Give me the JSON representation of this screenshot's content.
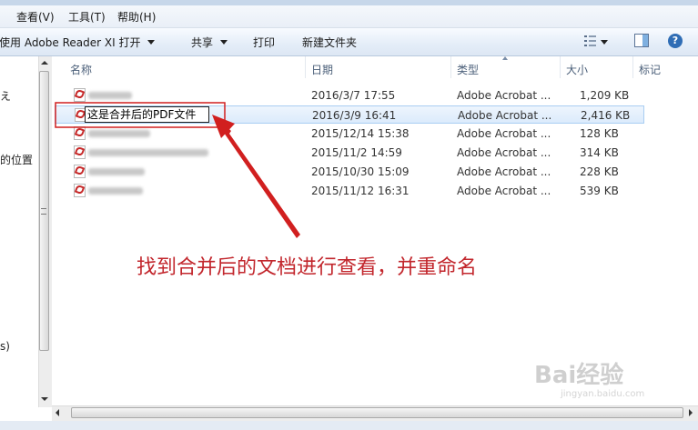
{
  "menu": [
    "查看(V)",
    "工具(T)",
    "帮助(H)"
  ],
  "toolbar": {
    "open_with": "使用 Adobe Reader XI 打开",
    "share": "共享",
    "print": "打印",
    "new_folder": "新建文件夹",
    "view_icon": "view-options-icon",
    "preview_icon": "preview-pane-icon",
    "help_icon": "help-icon"
  },
  "nav": {
    "items": [
      "え",
      "的位置",
      "s)"
    ]
  },
  "columns": [
    "名称",
    "日期",
    "类型",
    "大小",
    "标记"
  ],
  "files": [
    {
      "date": "2016/3/7 17:55",
      "type": "Adobe Acrobat ...",
      "size": "1,209 KB"
    },
    {
      "name": "这是合并后的PDF文件",
      "date": "2016/3/9 16:41",
      "type": "Adobe Acrobat ...",
      "size": "2,416 KB"
    },
    {
      "date": "2015/12/14 15:38",
      "type": "Adobe Acrobat ...",
      "size": "128 KB"
    },
    {
      "date": "2015/11/2 14:59",
      "type": "Adobe Acrobat ...",
      "size": "314 KB"
    },
    {
      "date": "2015/10/30 15:09",
      "type": "Adobe Acrobat ...",
      "size": "228 KB"
    },
    {
      "date": "2015/11/12 16:31",
      "type": "Adobe Acrobat ...",
      "size": "539 KB"
    }
  ],
  "annotation": "找到合并后的文档进行查看，并重命名",
  "watermark": "Bai经验",
  "watermark_sub": "jingyan.baidu.com",
  "colors": {
    "annotation": "#c2262c",
    "selection": "#dcebfc"
  }
}
